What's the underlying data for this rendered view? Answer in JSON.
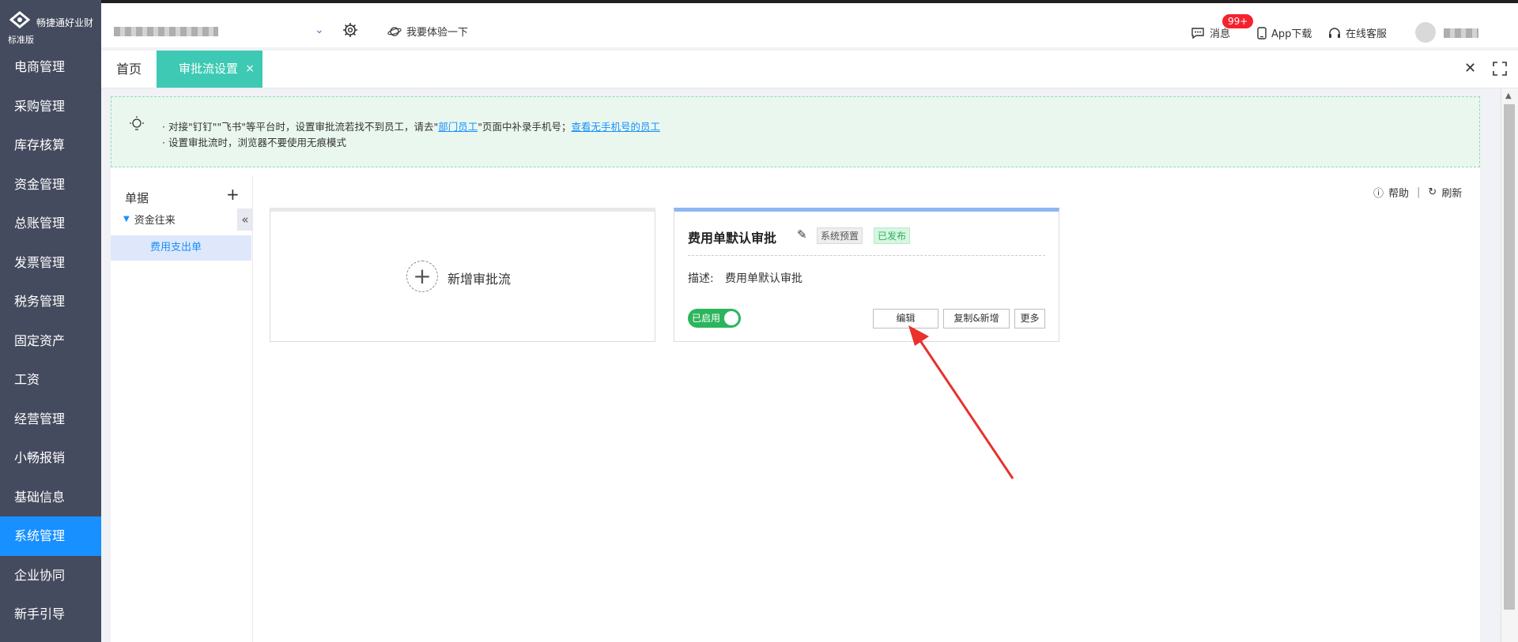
{
  "sidebar": {
    "brand": "畅捷通好业财",
    "edition": "标准版",
    "items": [
      {
        "label": "电商管理"
      },
      {
        "label": "采购管理"
      },
      {
        "label": "库存核算"
      },
      {
        "label": "资金管理"
      },
      {
        "label": "总账管理"
      },
      {
        "label": "发票管理"
      },
      {
        "label": "税务管理"
      },
      {
        "label": "固定资产"
      },
      {
        "label": "工资"
      },
      {
        "label": "经营管理"
      },
      {
        "label": "小畅报销"
      },
      {
        "label": "基础信息"
      },
      {
        "label": "系统管理",
        "active": true
      },
      {
        "label": "企业协同"
      },
      {
        "label": "新手引导"
      }
    ]
  },
  "topbar": {
    "try_label": "我要体验一下",
    "messages_label": "消息",
    "messages_badge": "99+",
    "app_download": "App下载",
    "online_service": "在线客服"
  },
  "tabs": {
    "home": "首页",
    "active": "审批流设置",
    "close_glyph": "×"
  },
  "notice": {
    "line1_prefix": "· 对接\"钉钉\"\"飞书\"等平台时，设置审批流若找不到员工，请去\"",
    "link1": "部门员工",
    "line1_mid": "\"页面中补录手机号；",
    "link2": "查看无手机号的员工",
    "line2": "· 设置审批流时，浏览器不要使用无痕模式"
  },
  "tree": {
    "title": "单据",
    "group": "资金往来",
    "leaf": "费用支出单"
  },
  "toolbar": {
    "help": "帮助",
    "refresh": "刷新"
  },
  "add_card": {
    "label": "新增审批流"
  },
  "flow_card": {
    "title": "费用单默认审批",
    "tag_system": "系统预置",
    "tag_published": "已发布",
    "desc_label": "描述:",
    "desc_value": "费用单默认审批",
    "toggle_label": "已启用",
    "btn_edit": "编辑",
    "btn_copy": "复制&新增",
    "btn_more": "更多"
  },
  "colors": {
    "sidebar_bg": "#454b5e",
    "active_nav": "#1890ff",
    "active_tab": "#3dc9b4",
    "toggle_on": "#2bb55c",
    "arrow": "#e8322b"
  }
}
